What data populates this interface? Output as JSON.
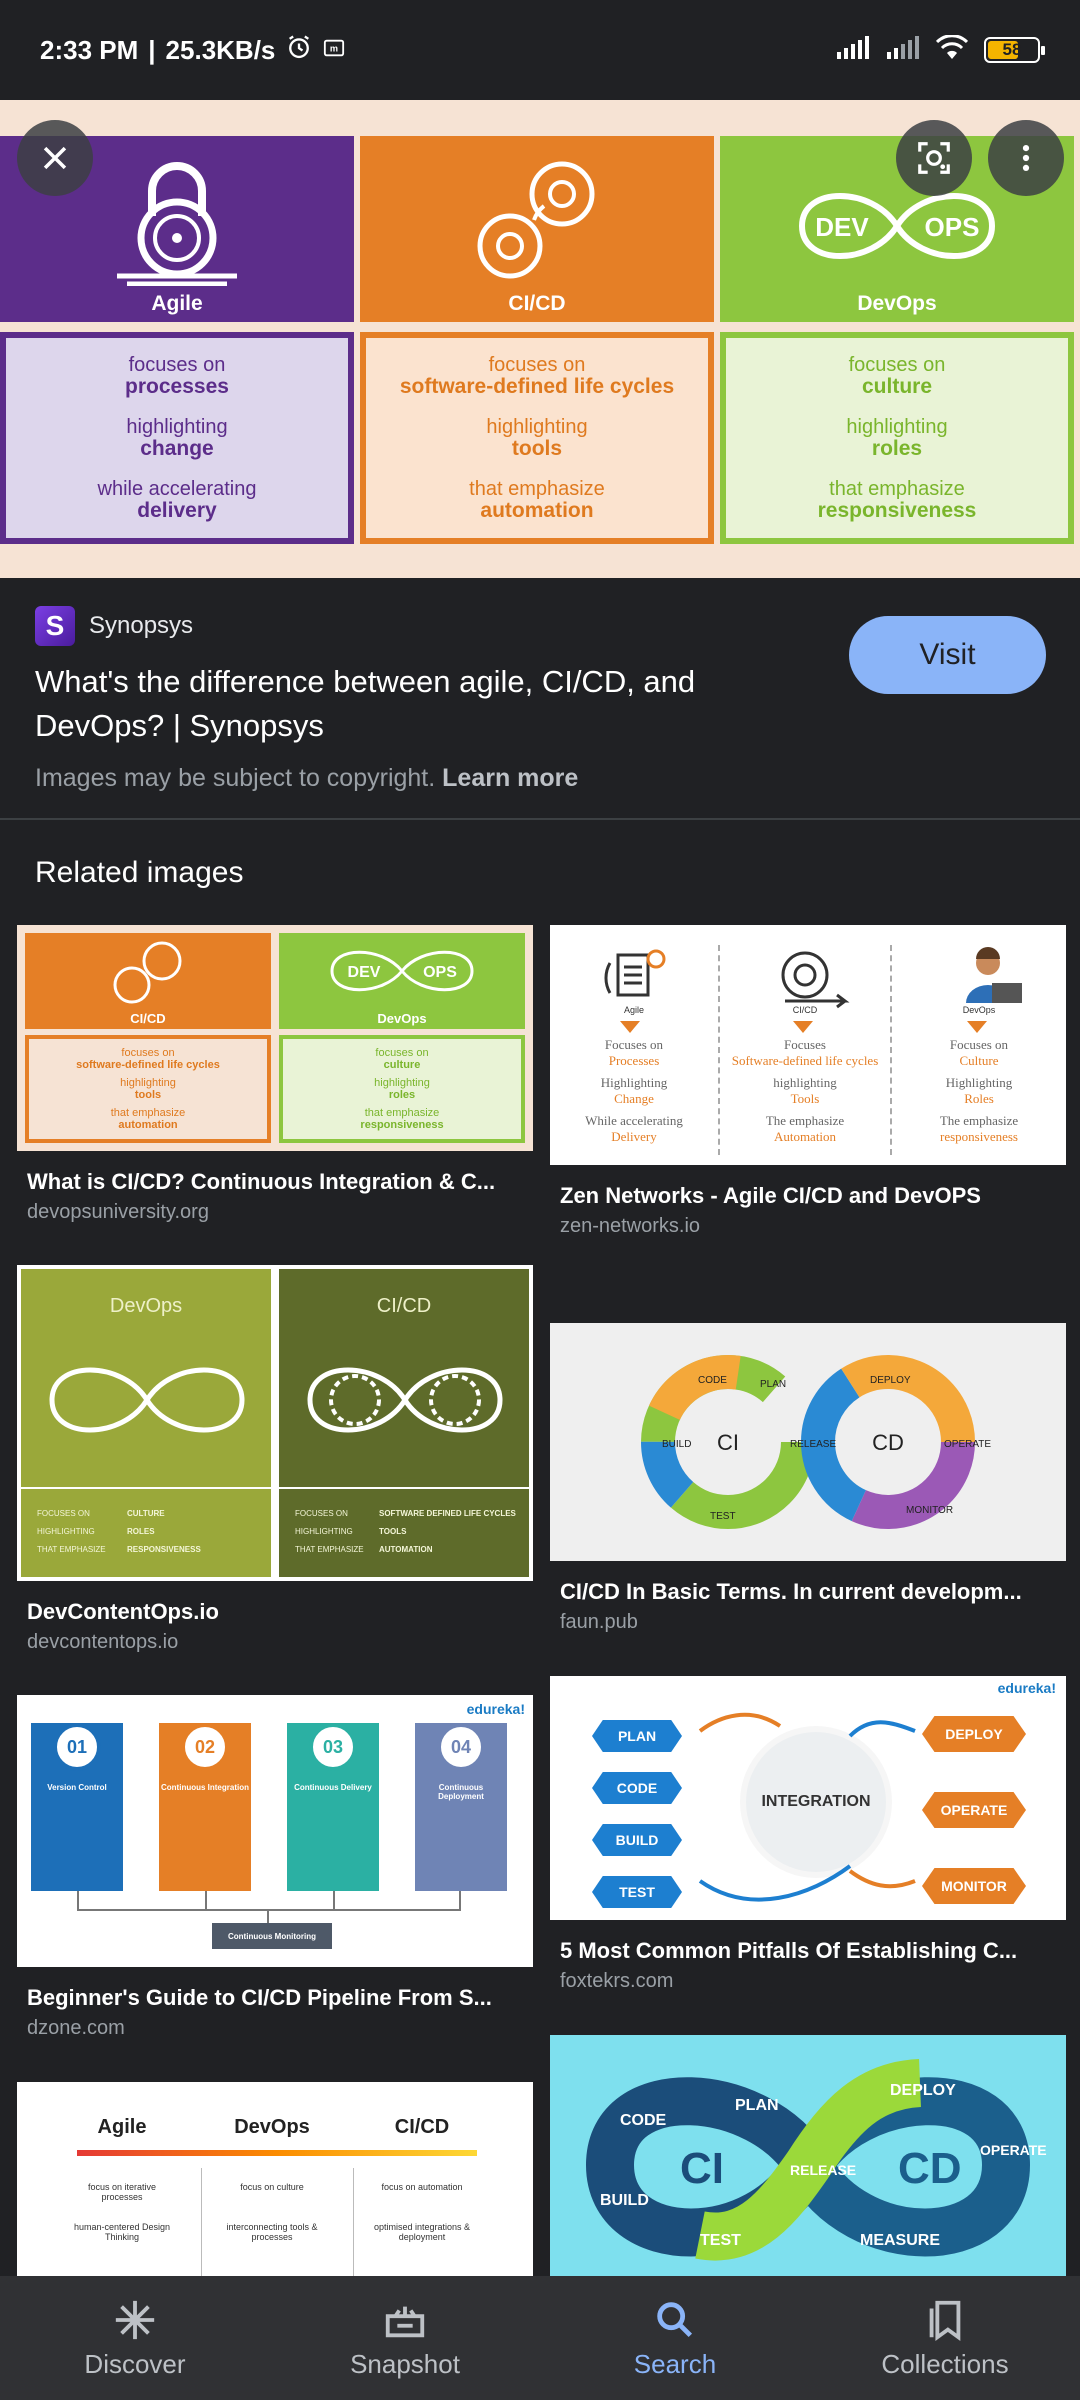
{
  "status_bar": {
    "time": "2:33 PM",
    "separator": "|",
    "speed": "25.3KB/s",
    "battery": "58"
  },
  "hero": {
    "columns": [
      {
        "title": "Agile",
        "lines": [
          {
            "t": "focuses on",
            "b": "processes"
          },
          {
            "t": "highlighting",
            "b": "change"
          },
          {
            "t": "while accelerating",
            "b": "delivery"
          }
        ]
      },
      {
        "title": "CI/CD",
        "lines": [
          {
            "t": "focuses on",
            "b": "software-defined life cycles"
          },
          {
            "t": "highlighting",
            "b": "tools"
          },
          {
            "t": "that emphasize",
            "b": "automation"
          }
        ]
      },
      {
        "title": "DevOps",
        "dev": "DEV",
        "ops": "OPS",
        "lines": [
          {
            "t": "focuses on",
            "b": "culture"
          },
          {
            "t": "highlighting",
            "b": "roles"
          },
          {
            "t": "that emphasize",
            "b": "responsiveness"
          }
        ]
      }
    ]
  },
  "source": {
    "favicon_letter": "S",
    "name": "Synopsys",
    "title": "What's the difference between agile, CI/CD, and DevOps? | Synopsys",
    "copyright": "Images may be subject to copyright.",
    "learn_more": "Learn more",
    "visit": "Visit"
  },
  "related": {
    "heading": "Related images",
    "items": [
      {
        "title": "What is CI/CD? Continuous Integration & C...",
        "domain": "devopsuniversity.org"
      },
      {
        "title": "Zen Networks - Agile CI/CD and DevOPS",
        "domain": "zen-networks.io"
      },
      {
        "title": "DevContentOps.io",
        "domain": "devcontentops.io"
      },
      {
        "title": "CI/CD In Basic Terms. In current developm...",
        "domain": "faun.pub"
      },
      {
        "title": "Beginner's Guide to CI/CD Pipeline From S...",
        "domain": "dzone.com"
      },
      {
        "title": "5 Most Common Pitfalls Of Establishing C...",
        "domain": "foxtekrs.com"
      }
    ],
    "thumbs": {
      "t1": {
        "left_title": "CI/CD",
        "right_title": "DevOps",
        "dev": "DEV",
        "ops": "OPS",
        "left": [
          "focuses on",
          "software-defined life cycles",
          "highlighting",
          "tools",
          "that emphasize",
          "automation"
        ],
        "right": [
          "focuses on",
          "culture",
          "highlighting",
          "roles",
          "that emphasize",
          "responsiveness"
        ]
      },
      "t2": {
        "cols": [
          {
            "title": "Agile",
            "lines": [
              "Focuses on",
              "Processes",
              "Highlighting",
              "Change",
              "While accelerating",
              "Delivery"
            ]
          },
          {
            "title": "CI/CD",
            "lines": [
              "Focuses",
              "Software-defined life cycles",
              "highlighting",
              "Tools",
              "The emphasize",
              "Automation"
            ]
          },
          {
            "title": "DevOps",
            "lines": [
              "Focuses on",
              "Culture",
              "Highlighting",
              "Roles",
              "The emphasize",
              "responsiveness"
            ]
          }
        ]
      },
      "t3": {
        "left_title": "DevOps",
        "right_title": "CI/CD",
        "left": [
          [
            "FOCUSES ON",
            "CULTURE"
          ],
          [
            "HIGHLIGHTING",
            "ROLES"
          ],
          [
            "THAT EMPHASIZE",
            "RESPONSIVENESS"
          ]
        ],
        "right": [
          [
            "FOCUSES ON",
            "SOFTWARE DEFINED LIFE CYCLES"
          ],
          [
            "HIGHLIGHTING",
            "TOOLS"
          ],
          [
            "THAT EMPHASIZE",
            "AUTOMATION"
          ]
        ]
      },
      "t4": {
        "ci": "CI",
        "cd": "CD",
        "labels": [
          "CODE",
          "PLAN",
          "BUILD",
          "TEST",
          "RELEASE",
          "DEPLOY",
          "OPERATE",
          "MONITOR"
        ]
      },
      "t5": {
        "brand": "edureka!",
        "steps": [
          {
            "num": "01",
            "title": "Version Control"
          },
          {
            "num": "02",
            "title": "Continuous Integration"
          },
          {
            "num": "03",
            "title": "Continuous Delivery"
          },
          {
            "num": "04",
            "title": "Continuous Deployment"
          }
        ],
        "footer": "Continuous Monitoring"
      },
      "t6": {
        "brand": "edureka!",
        "left": [
          "PLAN",
          "CODE",
          "BUILD",
          "TEST"
        ],
        "center": "INTEGRATION",
        "right": [
          "DEPLOY",
          "OPERATE",
          "MONITOR"
        ]
      },
      "t7": {
        "headers": [
          "Agile",
          "DevOps",
          "CI/CD"
        ],
        "rows": [
          [
            "focus on iterative processes",
            "focus on culture",
            "focus on automation"
          ],
          [
            "human-centered Design Thinking",
            "interconnecting tools & processes",
            "optimised integrations & deployment"
          ]
        ]
      },
      "t8": {
        "ci": "CI",
        "cd": "CD",
        "labels": [
          "CODE",
          "PLAN",
          "BUILD",
          "TEST",
          "RELEASE",
          "DEPLOY",
          "OPERATE",
          "MEASURE"
        ]
      }
    }
  },
  "nav": {
    "items": [
      {
        "label": "Discover"
      },
      {
        "label": "Snapshot"
      },
      {
        "label": "Search"
      },
      {
        "label": "Collections"
      }
    ],
    "active": "Search"
  }
}
